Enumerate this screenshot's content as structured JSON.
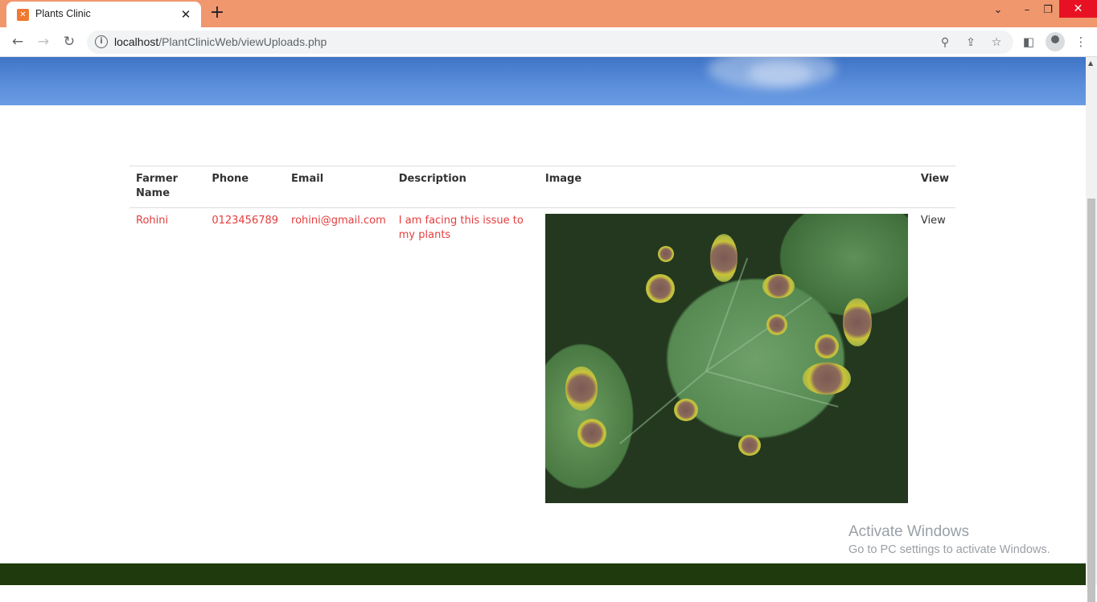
{
  "browser": {
    "tab_title": "Plants Clinic",
    "url_host": "localhost",
    "url_path": "/PlantClinicWeb/viewUploads.php"
  },
  "table": {
    "headers": {
      "farmer_name": "Farmer Name",
      "phone": "Phone",
      "email": "Email",
      "description": "Description",
      "image": "Image",
      "view": "View"
    },
    "rows": [
      {
        "farmer_name": "Rohini",
        "phone": "0123456789",
        "email": "rohini@gmail.com",
        "description": "I am facing this issue to my plants",
        "view": "View"
      }
    ]
  },
  "watermark": {
    "line1": "Activate Windows",
    "line2": "Go to PC settings to activate Windows."
  },
  "colors": {
    "tabbar": "#f0976e",
    "row_text": "#e43d3d",
    "footer": "#1f3a0c"
  }
}
